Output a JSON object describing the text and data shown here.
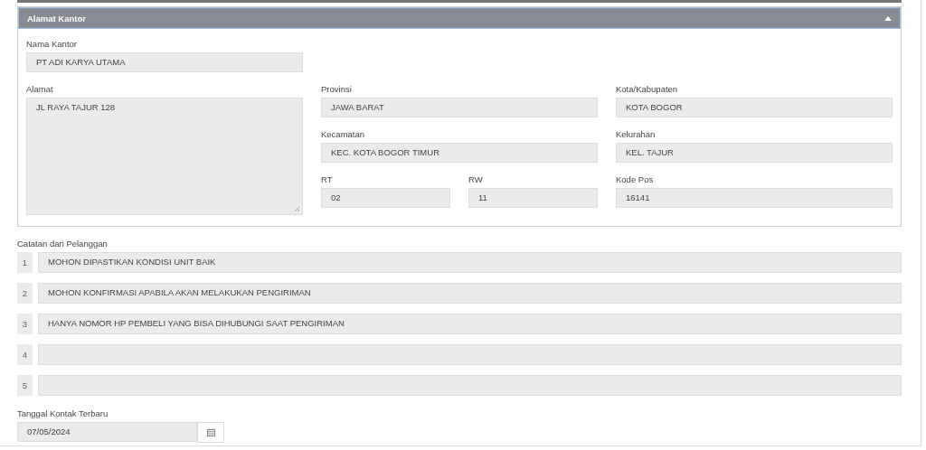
{
  "panel": {
    "title": "Alamat Kantor",
    "expanded": true,
    "fields": [
      {
        "label": "Nama Kantor",
        "value": "PT ADI KARYA UTAMA",
        "kind": "input"
      },
      {
        "label": "Alamat",
        "value": "JL RAYA TAJUR 128",
        "kind": "textarea"
      },
      {
        "label": "Provinsi",
        "value": "JAWA BARAT",
        "kind": "input"
      },
      {
        "label": "Kota/Kabupaten",
        "value": "KOTA BOGOR",
        "kind": "input"
      },
      {
        "label": "Kecamatan",
        "value": "KEC. KOTA BOGOR TIMUR",
        "kind": "input"
      },
      {
        "label": "Kelurahan",
        "value": "KEL. TAJUR",
        "kind": "input"
      },
      {
        "label": "RT",
        "value": "02",
        "kind": "input"
      },
      {
        "label": "RW",
        "value": "11",
        "kind": "input"
      },
      {
        "label": "Kode Pos",
        "value": "16141",
        "kind": "input"
      }
    ]
  },
  "notes": {
    "label": "Catatan dari Pelanggan",
    "rows": [
      {
        "number": "1",
        "value": "MOHON DIPASTIKAN KONDISI UNIT BAIK"
      },
      {
        "number": "2",
        "value": "MOHON KONFIRMASI APABILA AKAN MELAKUKAN PENGIRIMAN"
      },
      {
        "number": "3",
        "value": "HANYA NOMOR HP PEMBELI YANG BISA DIHUBUNGI SAAT PENGIRIMAN"
      },
      {
        "number": "4"
      },
      {
        "number": "5"
      }
    ]
  },
  "date": {
    "label": "Tanggal Kontak Terbaru",
    "value": "07/05/2024"
  }
}
